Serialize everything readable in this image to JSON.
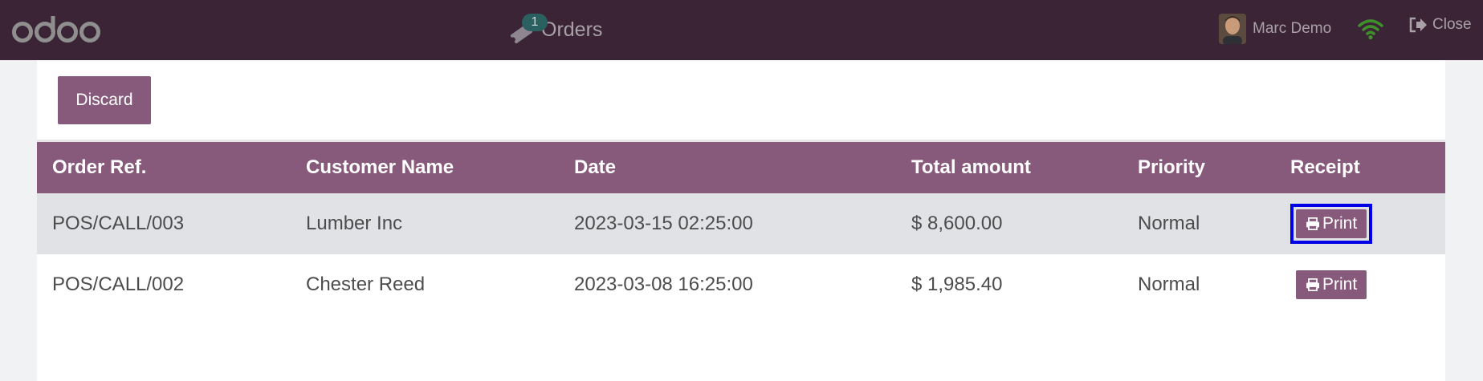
{
  "app": {
    "logo_text": "odoo",
    "icons": {
      "logo": "odoo-logo",
      "orders": "ticket-icon",
      "wifi": "wifi-icon",
      "close": "sign-out-icon",
      "print": "printer-icon"
    },
    "colors": {
      "topbar": "#3a2435",
      "accent": "#875a7b",
      "badge": "#2b6060",
      "wifi": "#3f8f2b",
      "focus": "#0000e6"
    }
  },
  "header": {
    "orders_badge": "1",
    "orders_label": "Orders",
    "user_name": "Marc Demo",
    "close_label": "Close"
  },
  "toolbar": {
    "discard_label": "Discard"
  },
  "table": {
    "columns": [
      "Order Ref.",
      "Customer Name",
      "Date",
      "Total amount",
      "Priority",
      "Receipt"
    ],
    "rows": [
      {
        "ref": "POS/CALL/003",
        "customer": "Lumber Inc",
        "date": "2023-03-15 02:25:00",
        "total": "$ 8,600.00",
        "priority": "Normal",
        "receipt_label": "Print",
        "selected": true
      },
      {
        "ref": "POS/CALL/002",
        "customer": "Chester Reed",
        "date": "2023-03-08 16:25:00",
        "total": "$ 1,985.40",
        "priority": "Normal",
        "receipt_label": "Print",
        "selected": false
      }
    ]
  }
}
